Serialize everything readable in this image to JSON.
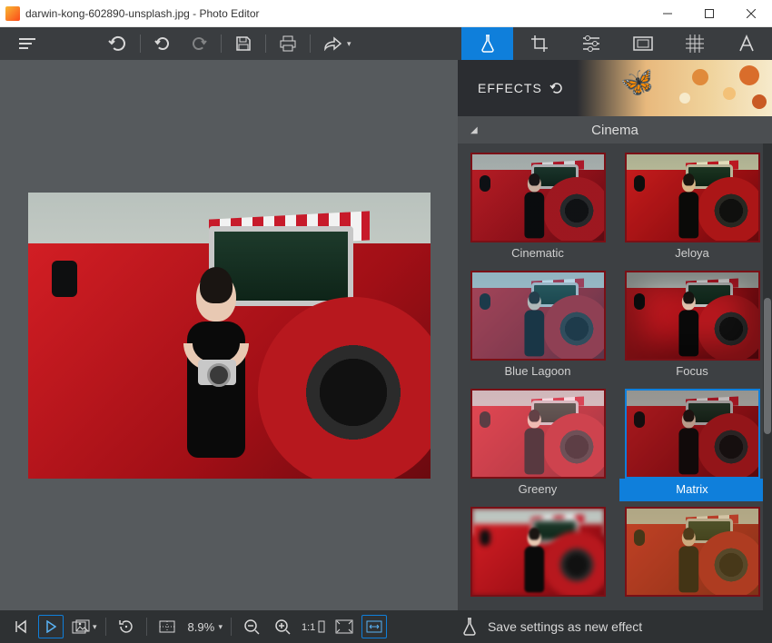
{
  "titlebar": {
    "text": "darwin-kong-602890-unsplash.jpg - Photo Editor"
  },
  "toolbar": {
    "menu": "menu-icon",
    "undo_big": "undo-icon",
    "undo": "undo-icon",
    "redo": "redo-icon",
    "save": "save-icon",
    "print": "print-icon",
    "share": "share-icon"
  },
  "tool_tabs": [
    {
      "name": "effects",
      "icon": "flask-icon",
      "active": true
    },
    {
      "name": "crop",
      "icon": "crop-icon",
      "active": false
    },
    {
      "name": "adjust",
      "icon": "sliders-icon",
      "active": false
    },
    {
      "name": "frame",
      "icon": "frame-icon",
      "active": false
    },
    {
      "name": "texture",
      "icon": "texture-icon",
      "active": false
    },
    {
      "name": "text",
      "icon": "text-icon",
      "active": false
    }
  ],
  "panel": {
    "section_label": "EFFECTS",
    "category": "Cinema",
    "effects": [
      {
        "label": "Cinematic",
        "filter": "flt-cinematic",
        "selected": false
      },
      {
        "label": "Jeloya",
        "filter": "flt-jeloya",
        "selected": false
      },
      {
        "label": "Blue Lagoon",
        "filter": "flt-bluelagoon",
        "selected": false
      },
      {
        "label": "Focus",
        "filter": "flt-focus",
        "selected": false
      },
      {
        "label": "Greeny",
        "filter": "flt-greeny",
        "selected": false
      },
      {
        "label": "Matrix",
        "filter": "flt-matrix",
        "selected": true
      },
      {
        "label": "",
        "filter": "flt-blur",
        "selected": false
      },
      {
        "label": "",
        "filter": "flt-sepia",
        "selected": false
      }
    ]
  },
  "bottombar": {
    "zoom_text": "8.9%",
    "save_effect_label": "Save settings as new effect"
  }
}
